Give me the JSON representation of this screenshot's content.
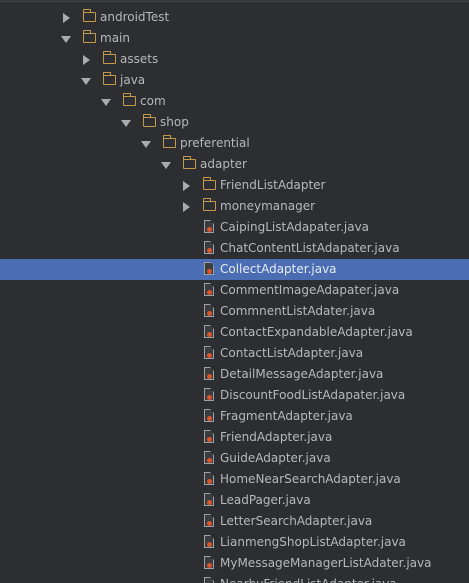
{
  "tree": {
    "nodes": [
      {
        "label": "androidTest",
        "kind": "folder",
        "state": "collapsed",
        "depth": 0
      },
      {
        "label": "main",
        "kind": "folder",
        "state": "expanded",
        "depth": 0
      },
      {
        "label": "assets",
        "kind": "folder",
        "state": "collapsed",
        "depth": 1
      },
      {
        "label": "java",
        "kind": "folder",
        "state": "expanded",
        "depth": 1
      },
      {
        "label": "com",
        "kind": "folder",
        "state": "expanded",
        "depth": 2
      },
      {
        "label": "shop",
        "kind": "folder",
        "state": "expanded",
        "depth": 3
      },
      {
        "label": "preferential",
        "kind": "folder",
        "state": "expanded",
        "depth": 4
      },
      {
        "label": "adapter",
        "kind": "folder",
        "state": "expanded",
        "depth": 5
      },
      {
        "label": "FriendListAdapter",
        "kind": "folder",
        "state": "collapsed",
        "depth": 6
      },
      {
        "label": "moneymanager",
        "kind": "folder",
        "state": "collapsed",
        "depth": 6
      },
      {
        "label": "CaipingListAdapater.java",
        "kind": "file",
        "depth": 6
      },
      {
        "label": "ChatContentListAdapater.java",
        "kind": "file",
        "depth": 6
      },
      {
        "label": "CollectAdapter.java",
        "kind": "file",
        "depth": 6,
        "selected": true
      },
      {
        "label": "CommentImageAdapater.java",
        "kind": "file",
        "depth": 6
      },
      {
        "label": "CommnentListAdater.java",
        "kind": "file",
        "depth": 6
      },
      {
        "label": "ContactExpandableAdapter.java",
        "kind": "file",
        "depth": 6
      },
      {
        "label": "ContactListAdapter.java",
        "kind": "file",
        "depth": 6
      },
      {
        "label": "DetailMessageAdapter.java",
        "kind": "file",
        "depth": 6
      },
      {
        "label": "DiscountFoodListAdapater.java",
        "kind": "file",
        "depth": 6
      },
      {
        "label": "FragmentAdapter.java",
        "kind": "file",
        "depth": 6
      },
      {
        "label": "FriendAdapter.java",
        "kind": "file",
        "depth": 6
      },
      {
        "label": "GuideAdapter.java",
        "kind": "file",
        "depth": 6
      },
      {
        "label": "HomeNearSearchAdapter.java",
        "kind": "file",
        "depth": 6
      },
      {
        "label": "LeadPager.java",
        "kind": "file",
        "depth": 6
      },
      {
        "label": "LetterSearchAdapter.java",
        "kind": "file",
        "depth": 6
      },
      {
        "label": "LianmengShopListAdapter.java",
        "kind": "file",
        "depth": 6
      },
      {
        "label": "MyMessageManagerListAdater.java",
        "kind": "file",
        "depth": 6
      },
      {
        "label": "NearbyFriendListAdapter.java",
        "kind": "file",
        "depth": 6,
        "partially_visible": true
      }
    ]
  },
  "colors": {
    "background": "#2c2e31",
    "text": "#b6b8ba",
    "selection": "#4a6db3",
    "folder": "#c39a4a",
    "file_badge": "#d9552b"
  },
  "icons": {
    "folder": "folder-icon",
    "java_file": "java-file-icon",
    "collapsed": "chevron-right-icon",
    "expanded": "chevron-down-icon"
  }
}
